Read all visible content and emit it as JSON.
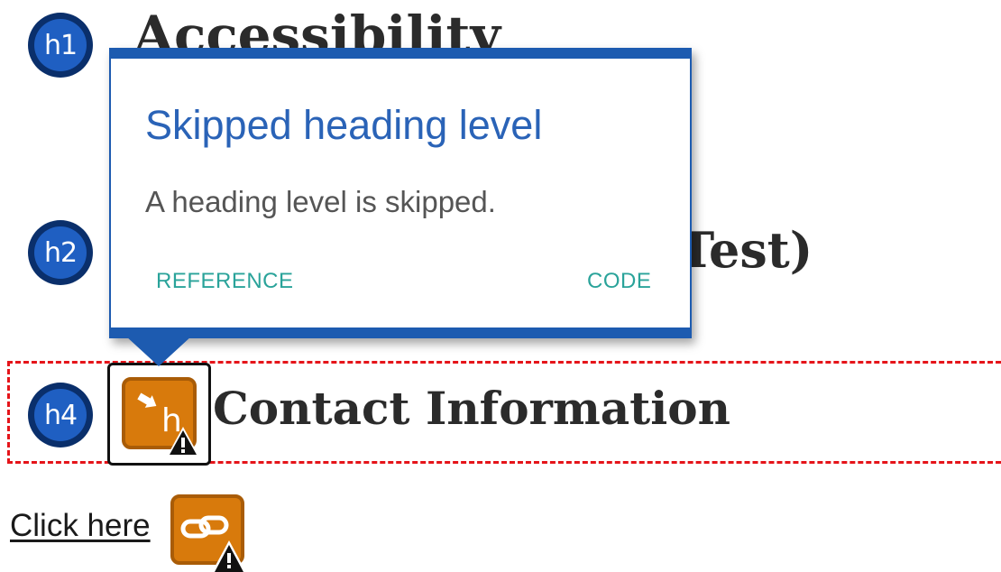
{
  "headings": {
    "h1": {
      "badge": "h1",
      "text": "Accessibility"
    },
    "h2": {
      "badge": "h2",
      "text_visible_fragment": "Test)"
    },
    "h4": {
      "badge": "h4",
      "text": "Contact Information"
    }
  },
  "popover": {
    "title": "Skipped heading level",
    "description": "A heading level is skipped.",
    "reference_label": "REFERENCE",
    "code_label": "CODE"
  },
  "link": {
    "text": "Click here"
  },
  "icons": {
    "heading_issue": "skipped-heading-icon",
    "link_issue": "link-icon",
    "warning": "warning-triangle-icon"
  },
  "colors": {
    "badge_bg": "#1f5fc2",
    "badge_ring": "#0a2f6b",
    "popover_accent": "#1d5bb0",
    "popover_title": "#2a63b7",
    "popover_link": "#2aa39a",
    "issue_orange": "#d87a0c",
    "outline_red": "#e5141a"
  }
}
